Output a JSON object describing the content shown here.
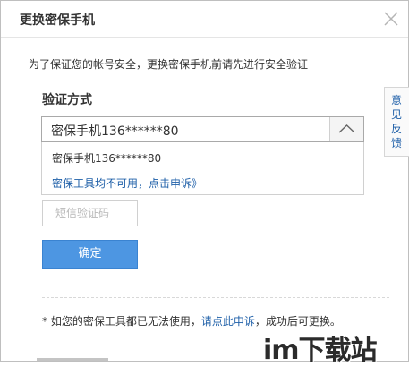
{
  "dialog": {
    "title": "更换密保手机",
    "description": "为了保证您的帐号安全，更换密保手机前请先进行安全验证"
  },
  "verification": {
    "label": "验证方式",
    "selected": "密保手机136******80",
    "options": [
      "密保手机136******80"
    ],
    "appeal_link": "密保工具均不可用，点击申诉》"
  },
  "sms_code": {
    "placeholder": "短信验证码"
  },
  "confirm_button": "确定",
  "footer": {
    "prefix": "* 如您的密保工具都已无法使用，",
    "link": "请点此申诉",
    "suffix": "，成功后可更换。"
  },
  "feedback_tab": "意见反馈",
  "watermark": "im下载站",
  "colors": {
    "accent": "#4d96e2",
    "link": "#1e5fa8",
    "text": "#333333"
  },
  "icons": {
    "close": "close-icon",
    "toggle": "chevron-up-icon"
  }
}
